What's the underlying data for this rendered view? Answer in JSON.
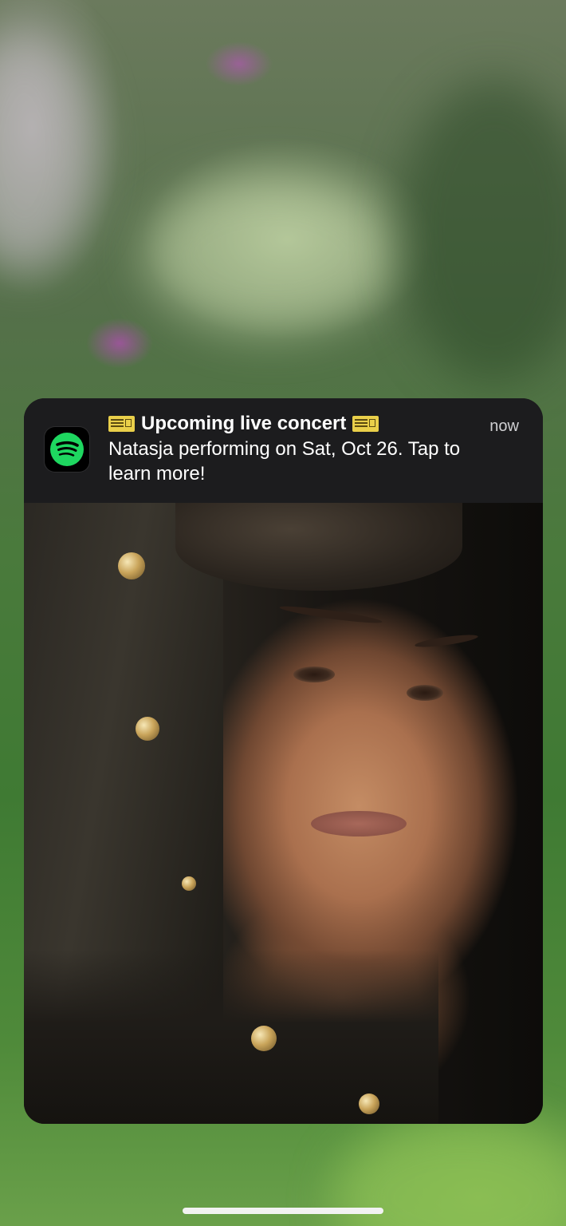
{
  "notification": {
    "app_icon": "spotify-icon",
    "title": "Upcoming live concert",
    "title_icon": "ticket-emoji",
    "time": "now",
    "body": "Natasja performing on Sat, Oct 26. Tap to learn more!",
    "image": "artist-photo"
  },
  "colors": {
    "notification_bg": "#1c1c1e",
    "spotify_green": "#1ed760",
    "text_primary": "#ffffff",
    "text_secondary": "#cfcfd2",
    "ticket_yellow": "#e9cf4a"
  }
}
